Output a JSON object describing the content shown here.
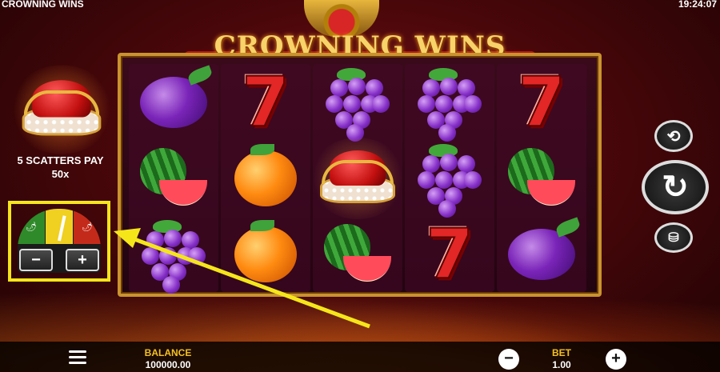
{
  "game": {
    "name": "CROWNING WINS",
    "clock": "19:24:07",
    "logo_title": "CROWNING WINS"
  },
  "grid": [
    [
      "plum",
      "seven",
      "grapes",
      "grapes",
      "seven"
    ],
    [
      "watermelon",
      "orange",
      "crown",
      "grapes",
      "watermelon"
    ],
    [
      "grapes",
      "orange",
      "watermelon",
      "seven",
      "plum"
    ]
  ],
  "seven_glyph": "7",
  "scatter": {
    "line1": "5 SCATTERS PAY",
    "line2": "50x",
    "icon": "crown-icon"
  },
  "volatility": {
    "minus": "−",
    "plus": "+",
    "level": "medium"
  },
  "controls": {
    "autoplay_icon": "autoplay-icon",
    "spin_icon": "spin-icon",
    "bet_icon": "coins-icon"
  },
  "bottom": {
    "balance_label": "BALANCE",
    "balance_value": "100000.00",
    "bet_label": "BET",
    "bet_value": "1.00",
    "minus": "−",
    "plus": "+"
  },
  "colors": {
    "highlight": "#f5e61a",
    "frame": "#c9932f",
    "label": "#f4c020"
  }
}
